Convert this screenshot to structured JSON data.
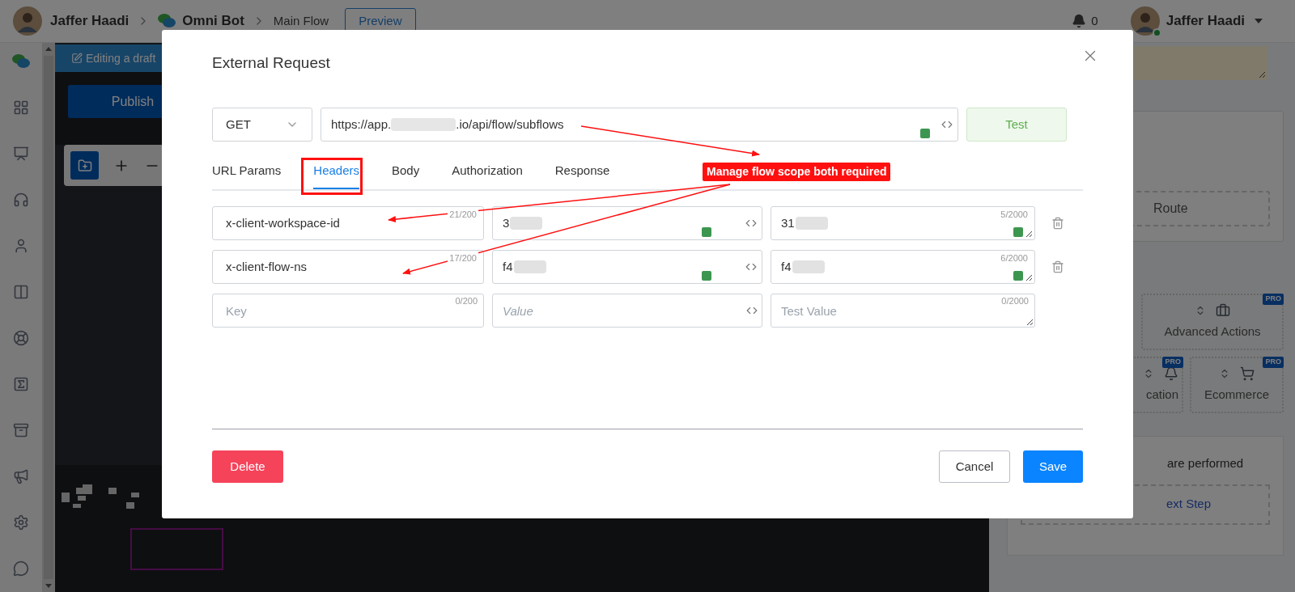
{
  "top_bar": {
    "breadcrumb": [
      {
        "kind": "user",
        "label": "Jaffer Haadi"
      },
      {
        "kind": "bot",
        "label": "Omni Bot"
      },
      {
        "kind": "page",
        "label": "Main Flow"
      }
    ],
    "preview_button": "Preview",
    "notifications": "0",
    "user": {
      "name": "Jaffer Haadi",
      "online": true
    }
  },
  "editor": {
    "draft_notice": "Editing a draft",
    "publish_button": "Publish"
  },
  "right_panel": {
    "route": "Route",
    "actions": [
      {
        "label": "Advanced Actions",
        "badge": "PRO",
        "kind": "briefcase"
      },
      {
        "label": "cation",
        "badge": "PRO",
        "kind": "bell"
      },
      {
        "label": "Ecommerce",
        "badge": "PRO",
        "kind": "cart"
      }
    ],
    "note": "are performed",
    "next_step": "ext Step"
  },
  "modal": {
    "title": "External Request",
    "method": "GET",
    "url": {
      "start": "https://app.",
      "end": ".io/api/flow/subflows",
      "redacted": true
    },
    "test_button": "Test",
    "tabs": [
      {
        "label": "URL Params",
        "selected": false
      },
      {
        "label": "Headers",
        "selected": true
      },
      {
        "label": "Body",
        "selected": false
      },
      {
        "label": "Authorization",
        "selected": false
      },
      {
        "label": "Response",
        "selected": false
      }
    ],
    "headers": [
      {
        "key": "x-client-workspace-id",
        "key_count": "21/200",
        "value": "3",
        "value_redacted": true,
        "test_value": "31",
        "test_redacted": true,
        "test_count": "5/2000",
        "removable": true
      },
      {
        "key": "x-client-flow-ns",
        "key_count": "17/200",
        "value": "f4",
        "value_redacted": true,
        "test_value": "f4",
        "test_redacted": true,
        "test_count": "6/2000",
        "removable": true
      }
    ],
    "new_header": {
      "key_placeholder": "Key",
      "key_count": "0/200",
      "value_placeholder": "Value",
      "test_placeholder": "Test Value",
      "test_count": "0/2000"
    },
    "footer": {
      "delete_button": "Delete",
      "cancel_button": "Cancel",
      "save_button": "Save"
    }
  },
  "annotation": {
    "label": "Manage flow scope both required"
  }
}
